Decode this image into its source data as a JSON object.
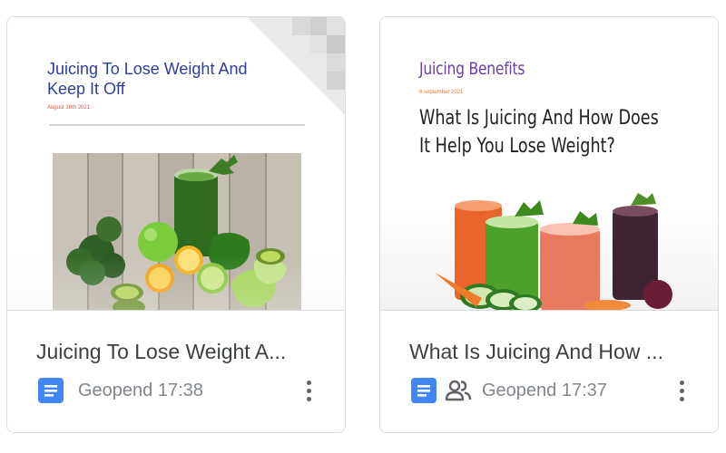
{
  "files": [
    {
      "thumbnail": {
        "title": "Juicing To Lose Weight And Keep It Off",
        "date": "August 16th 2021"
      },
      "title": "Juicing To Lose Weight A...",
      "type_icon": "google-docs-icon",
      "shared": false,
      "opened": "Geopend 17:38",
      "more_icon": "more-vert-icon"
    },
    {
      "thumbnail": {
        "heading": "Juicing Benefits",
        "date": "6 september 2021",
        "title": "What Is Juicing And How Does It Help You Lose Weight?"
      },
      "title": "What Is Juicing And How ...",
      "type_icon": "google-docs-icon",
      "shared": true,
      "shared_icon": "shared-people-icon",
      "opened": "Geopend 17:37",
      "more_icon": "more-vert-icon"
    }
  ],
  "colors": {
    "docs_blue": "#4285f4",
    "title_text": "#3c4043",
    "meta_text": "#80868b",
    "doc1_title": "#2f3f9e",
    "doc2_heading": "#6c3fa3"
  }
}
